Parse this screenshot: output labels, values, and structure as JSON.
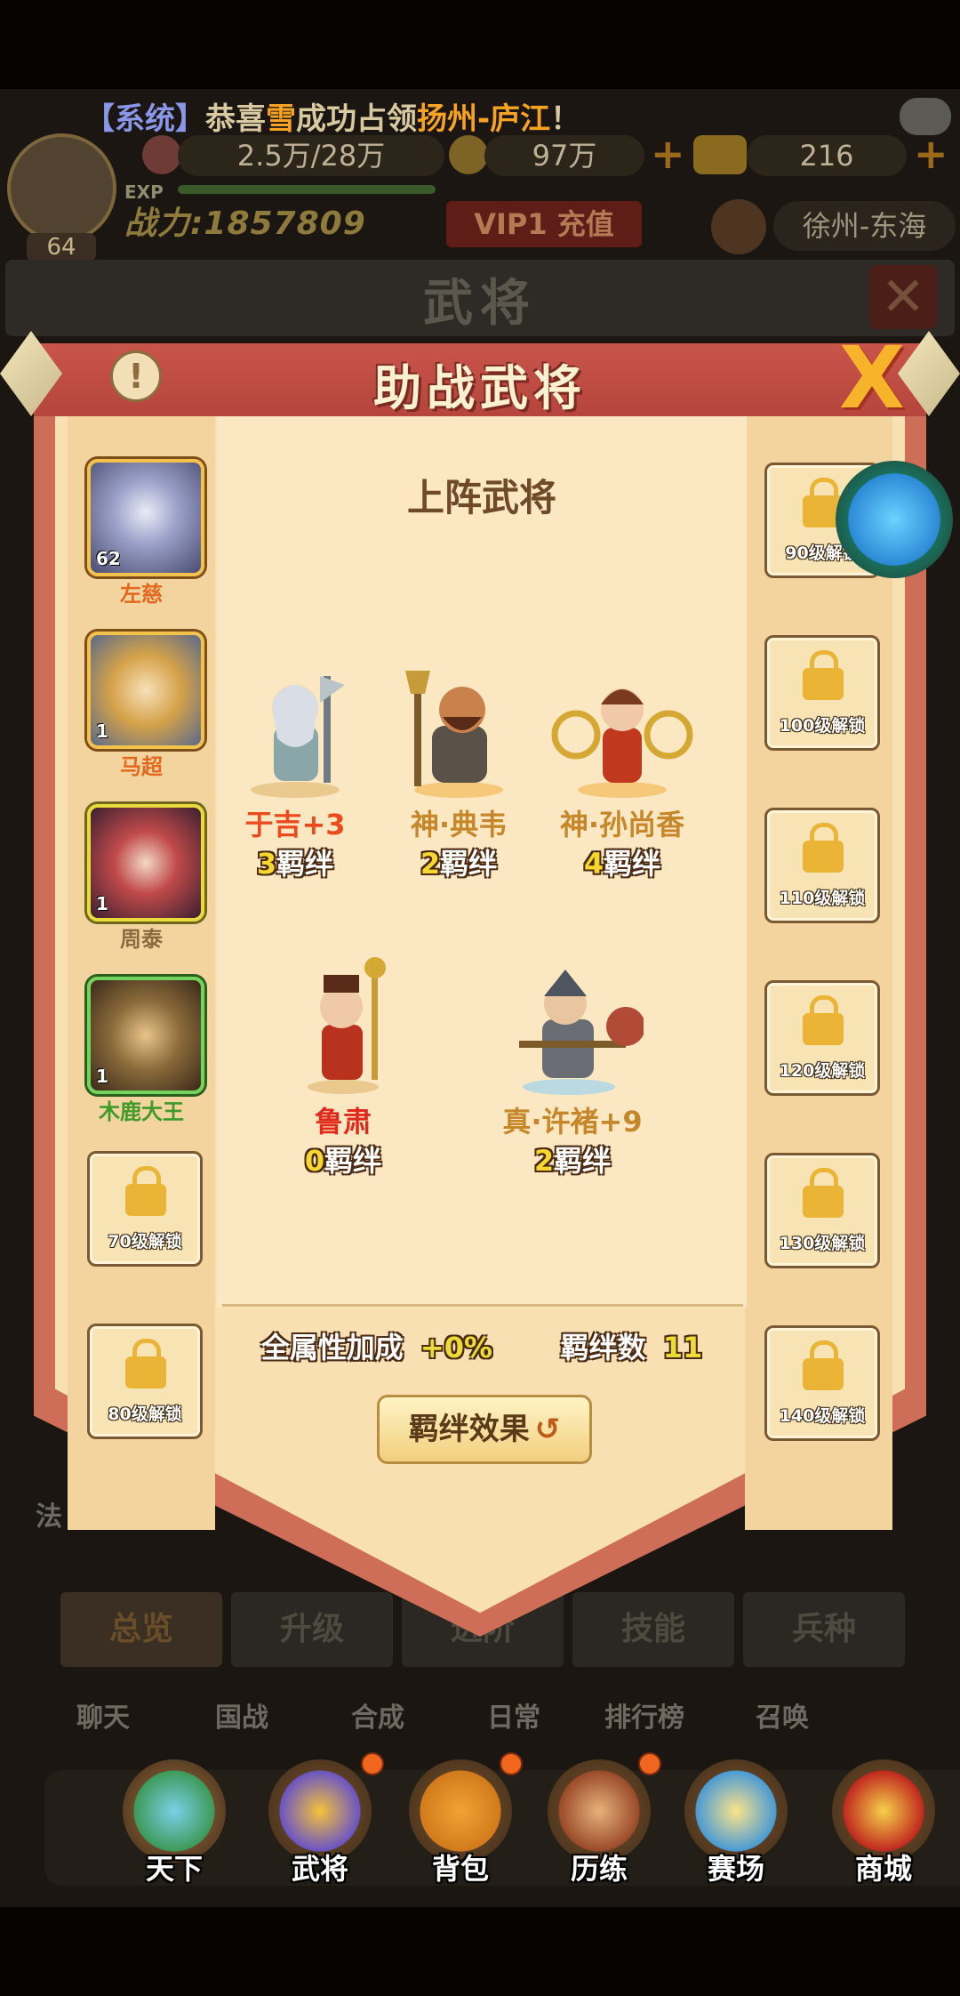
{
  "hud": {
    "ticker": {
      "tag": "【系统】",
      "pre": "恭喜",
      "player": "雪",
      "mid": "成功占领",
      "place": "扬州-庐江",
      "end": "！"
    },
    "level": "64",
    "exp_label": "EXP",
    "power": "战力:1857809",
    "food": "2.5万/28万",
    "coins": "97万",
    "gold": "216",
    "vip": "VIP1 充值",
    "location": "徐州-东海",
    "outer_title": "武将",
    "outer_close": "✕",
    "tabs": [
      "总览",
      "升级",
      "进阶",
      "技能",
      "兵种"
    ],
    "mid_labels": [
      "聊天",
      "国战",
      "合成",
      "日常",
      "排行榜",
      "召唤"
    ],
    "side_hint": "法"
  },
  "nav": [
    {
      "label": "天下",
      "icon": "world-map-icon",
      "dot": false
    },
    {
      "label": "武将",
      "icon": "general-helmet-icon",
      "dot": true
    },
    {
      "label": "背包",
      "icon": "backpack-icon",
      "dot": true
    },
    {
      "label": "历练",
      "icon": "training-icon",
      "dot": true
    },
    {
      "label": "赛场",
      "icon": "arena-icon",
      "dot": false
    },
    {
      "label": "商城",
      "icon": "shop-icon",
      "dot": false
    }
  ],
  "popup": {
    "title": "助战武将",
    "warning": "!",
    "close": "X",
    "section_title": "上阵武将",
    "stats_label": "全属性加成",
    "stats_value": "+0%",
    "bond_count_label": "羁绊数",
    "bond_count": "11",
    "effect_button": "羁绊效果",
    "effect_icon": "↺"
  },
  "left_slots": [
    {
      "type": "hero",
      "name": "左慈",
      "level": "62",
      "name_color": "#e2691f",
      "frame": "gold",
      "face": "#8a8fb0"
    },
    {
      "type": "hero",
      "name": "马超",
      "level": "1",
      "name_color": "#e2691f",
      "frame": "gold",
      "face": "#d5a24a"
    },
    {
      "type": "hero",
      "name": "周泰",
      "level": "1",
      "name_color": "#8a6a3f",
      "frame": "yellow",
      "face": "#9b3a3a"
    },
    {
      "type": "hero",
      "name": "木鹿大王",
      "level": "1",
      "name_color": "#3f9a2a",
      "frame": "green",
      "face": "#8a6a3a"
    },
    {
      "type": "locked",
      "text": "70级解锁"
    },
    {
      "type": "locked",
      "text": "80级解锁"
    }
  ],
  "right_slots": [
    {
      "type": "locked",
      "text": "90级解锁"
    },
    {
      "type": "locked",
      "text": "100级解锁"
    },
    {
      "type": "locked",
      "text": "110级解锁"
    },
    {
      "type": "locked",
      "text": "120级解锁"
    },
    {
      "type": "locked",
      "text": "130级解锁"
    },
    {
      "type": "locked",
      "text": "140级解锁"
    }
  ],
  "generals": [
    {
      "name": "于吉+3",
      "bond_num": "3",
      "bond_label": "羁绊",
      "name_color": "#ea4a1c"
    },
    {
      "name": "神·典韦",
      "bond_num": "2",
      "bond_label": "羁绊",
      "name_color": "#c6862a"
    },
    {
      "name": "神·孙尚香",
      "bond_num": "4",
      "bond_label": "羁绊",
      "name_color": "#c6862a"
    },
    {
      "name": "鲁肃",
      "bond_num": "0",
      "bond_label": "羁绊",
      "name_color": "#e02b1c"
    },
    {
      "name": "真·许褚+9",
      "bond_num": "2",
      "bond_label": "羁绊",
      "name_color": "#c6862a"
    }
  ]
}
